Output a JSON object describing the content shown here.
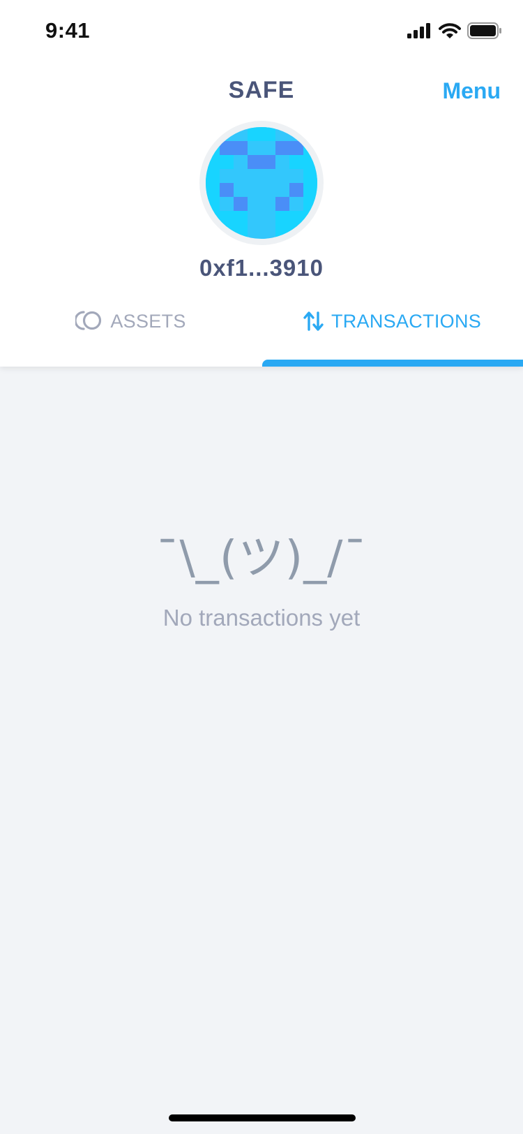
{
  "status_bar": {
    "time": "9:41",
    "icons": [
      "signal-icon",
      "wifi-icon",
      "battery-icon"
    ]
  },
  "header": {
    "title": "SAFE",
    "menu_label": "Menu",
    "avatar": "safe-identicon",
    "address": "0xf1...3910"
  },
  "tabs": [
    {
      "label": "ASSETS",
      "icon": "coins-icon",
      "active": false
    },
    {
      "label": "TRANSACTIONS",
      "icon": "transfer-arrows-icon",
      "active": true
    }
  ],
  "empty_state": {
    "emoticon": "¯\\_(ツ)_/¯",
    "message": "No transactions yet"
  },
  "colors": {
    "accent": "#2aa9f3",
    "title": "#4a5579",
    "muted": "#a2a8ba",
    "background": "#f2f4f7",
    "identicon_light": "#18d4ff",
    "identicon_mid": "#33c7fc",
    "identicon_dark": "#4a8ef7"
  }
}
